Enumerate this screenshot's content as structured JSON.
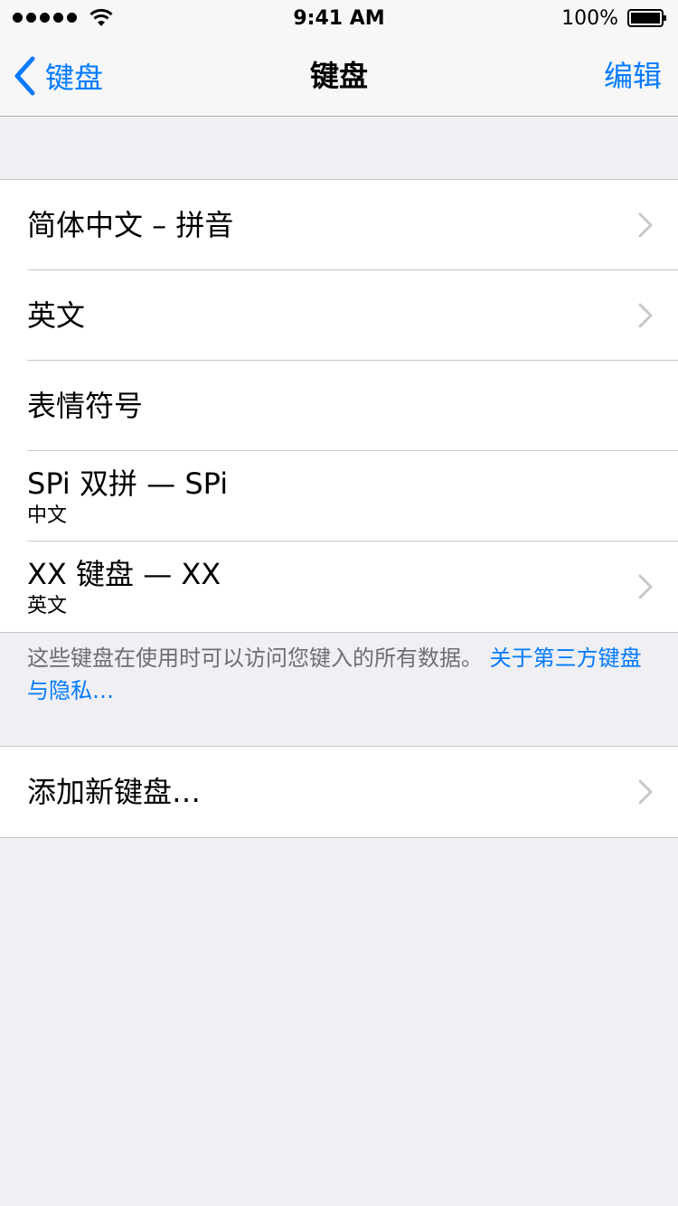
{
  "status_bar": {
    "time": "9:41 AM",
    "battery": "100%"
  },
  "nav": {
    "back_label": "键盘",
    "title": "键盘",
    "edit_label": "编辑"
  },
  "keyboards": [
    {
      "title": "简体中文 – 拼音",
      "subtitle": "",
      "chevron": true
    },
    {
      "title": "英文",
      "subtitle": "",
      "chevron": true
    },
    {
      "title": "表情符号",
      "subtitle": "",
      "chevron": false
    },
    {
      "title": "SPi 双拼 — SPi",
      "subtitle": "中文",
      "chevron": false
    },
    {
      "title": "XX 键盘 — XX",
      "subtitle": "英文",
      "chevron": true
    }
  ],
  "footer": {
    "text": "这些键盘在使用时可以访问您键入的所有数据。 ",
    "link": "关于第三方键盘与隐私…"
  },
  "add_keyboard": {
    "label": "添加新键盘…"
  },
  "colors": {
    "accent": "#007aff",
    "background": "#efeff4",
    "separator": "#c8c7cc"
  }
}
